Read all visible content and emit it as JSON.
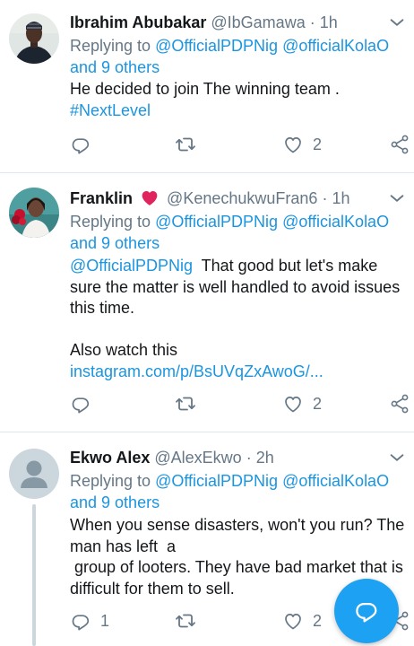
{
  "tweets": [
    {
      "name": "Ibrahim Abubakar",
      "handle": "@IbGamawa",
      "dot": "·",
      "time": "1h",
      "replying_prefix": "Replying to",
      "replying_to_1": "@OfficialPDPNig",
      "replying_to_2": "@officialKolaO",
      "replying_others": "and 9 others",
      "text_line_1": "He decided to join The winning team .",
      "hashtag": "#NextLevel",
      "reply_count": "",
      "like_count": "2"
    },
    {
      "name": "Franklin",
      "handle": "@KenechukwuFran6",
      "dot": "·",
      "time": "1h",
      "replying_prefix": "Replying to",
      "replying_to_1": "@OfficialPDPNig",
      "replying_to_2": "@officialKolaO",
      "replying_others": "and 9 others",
      "mention": "@OfficialPDPNig",
      "text_line_1": "  That good but let's make",
      "text_line_2": "sure the matter is well handled to avoid issues",
      "text_line_3": "this time.",
      "text_line_4": "Also watch this",
      "link": "instagram.com/p/BsUVqZxAwoG/...",
      "reply_count": "",
      "like_count": "2"
    },
    {
      "name": "Ekwo Alex",
      "handle": "@AlexEkwo",
      "dot": "·",
      "time": "2h",
      "replying_prefix": "Replying to",
      "replying_to_1": "@OfficialPDPNig",
      "replying_to_2": "@officialKolaO",
      "replying_others": "and 9 others",
      "text_line_1": "When you sense disasters, won't you run? The",
      "text_line_2": "man has left  a",
      "text_line_3": " group of looters. They have bad market that is",
      "text_line_4": "difficult for them to sell.",
      "reply_count": "1",
      "like_count": "2"
    }
  ],
  "icons": {
    "reply": "reply-icon",
    "retweet": "retweet-icon",
    "like": "like-icon",
    "share": "share-icon",
    "caret": "chevron-down-icon",
    "heart_emoji": "red-heart-icon",
    "fab": "compose-reply-icon"
  },
  "colors": {
    "link": "#1b95e0",
    "secondary": "#657786",
    "fab": "#1da1f2",
    "heart": "#e0245e"
  }
}
